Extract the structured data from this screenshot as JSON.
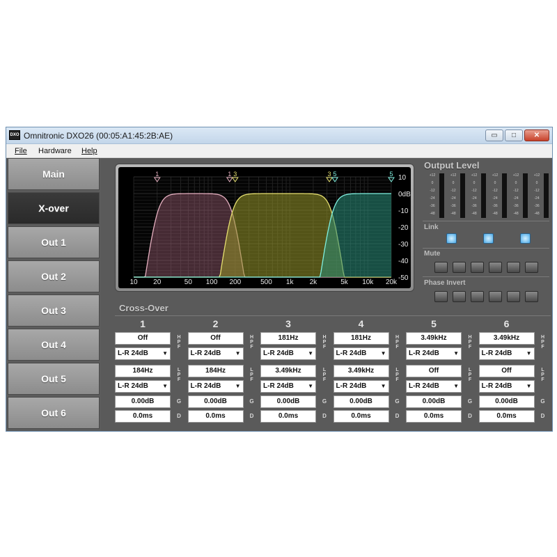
{
  "window": {
    "title": "Omnitronic DXO26 (00:05:A1:45:2B:AE)",
    "icon_text": "DXO",
    "controls": {
      "minimize": "▭",
      "maximize": "□",
      "close": "✕"
    }
  },
  "menu": [
    {
      "label": "File",
      "underline": true
    },
    {
      "label": "Hardware",
      "underline": false
    },
    {
      "label": "Help",
      "underline": true
    }
  ],
  "nav": [
    {
      "label": "Main",
      "active": false
    },
    {
      "label": "X-over",
      "active": true
    },
    {
      "label": "Out 1",
      "active": false
    },
    {
      "label": "Out 2",
      "active": false
    },
    {
      "label": "Out 3",
      "active": false
    },
    {
      "label": "Out 4",
      "active": false
    },
    {
      "label": "Out 5",
      "active": false
    },
    {
      "label": "Out 6",
      "active": false
    }
  ],
  "graph": {
    "x_ticks": [
      "10",
      "20",
      "50",
      "100",
      "200",
      "500",
      "1k",
      "2k",
      "5k",
      "10k",
      "20k"
    ],
    "x_tick_values": [
      10,
      20,
      50,
      100,
      200,
      500,
      1000,
      2000,
      5000,
      10000,
      20000
    ],
    "y_ticks": [
      "10",
      "0dB",
      "-10",
      "-20",
      "-30",
      "-40",
      "-50"
    ],
    "y_tick_values": [
      10,
      0,
      -10,
      -20,
      -30,
      -40,
      -50
    ],
    "x_range": [
      10,
      20000
    ],
    "y_range": [
      -50,
      10
    ],
    "markers": [
      {
        "label": "1",
        "freq": 20,
        "color": "#e6b0c0"
      },
      {
        "label": "1",
        "freq": 184,
        "color": "#e6b0c0"
      },
      {
        "label": "3",
        "freq": 184,
        "color": "#e6e070"
      },
      {
        "label": "3",
        "freq": 3490,
        "color": "#e6e070"
      },
      {
        "label": "5",
        "freq": 3490,
        "color": "#80f0e0"
      },
      {
        "label": "5",
        "freq": 20000,
        "color": "#80f0e0"
      }
    ],
    "bands": [
      {
        "name_hidden": "pair-1-2",
        "hpf": 20,
        "lpf": 184,
        "fill": "rgba(150,90,110,0.45)",
        "stroke": "#e6b0c0"
      },
      {
        "name_hidden": "pair-3-4",
        "hpf": 181,
        "lpf": 3490,
        "fill": "rgba(150,150,40,0.55)",
        "stroke": "#e6e070"
      },
      {
        "name_hidden": "pair-5-6",
        "hpf": 3490,
        "lpf": 20000,
        "fill": "rgba(40,140,120,0.55)",
        "stroke": "#80f0e0"
      }
    ]
  },
  "output_level": {
    "title": "Output Level",
    "scale": [
      "+12",
      "0",
      "-12",
      "-24",
      "-36",
      "-48"
    ]
  },
  "link": {
    "title": "Link",
    "count": 3
  },
  "mute": {
    "title": "Mute",
    "count": 6
  },
  "phase": {
    "title": "Phase Invert",
    "count": 6
  },
  "crossover": {
    "title": "Cross-Over",
    "hpf_label": [
      "H",
      "P",
      "F"
    ],
    "lpf_label": [
      "L",
      "P",
      "F"
    ],
    "gain_label": "G",
    "delay_label": "D",
    "channels": [
      {
        "num": "1",
        "hpf": "Off",
        "hpf_type": "L-R 24dB",
        "lpf": "184Hz",
        "lpf_type": "L-R 24dB",
        "gain": "0.00dB",
        "delay": "0.0ms"
      },
      {
        "num": "2",
        "hpf": "Off",
        "hpf_type": "L-R 24dB",
        "lpf": "184Hz",
        "lpf_type": "L-R 24dB",
        "gain": "0.00dB",
        "delay": "0.0ms"
      },
      {
        "num": "3",
        "hpf": "181Hz",
        "hpf_type": "L-R 24dB",
        "lpf": "3.49kHz",
        "lpf_type": "L-R 24dB",
        "gain": "0.00dB",
        "delay": "0.0ms"
      },
      {
        "num": "4",
        "hpf": "181Hz",
        "hpf_type": "L-R 24dB",
        "lpf": "3.49kHz",
        "lpf_type": "L-R 24dB",
        "gain": "0.00dB",
        "delay": "0.0ms"
      },
      {
        "num": "5",
        "hpf": "3.49kHz",
        "hpf_type": "L-R 24dB",
        "lpf": "Off",
        "lpf_type": "L-R 24dB",
        "gain": "0.00dB",
        "delay": "0.0ms"
      },
      {
        "num": "6",
        "hpf": "3.49kHz",
        "hpf_type": "L-R 24dB",
        "lpf": "Off",
        "lpf_type": "L-R 24dB",
        "gain": "0.00dB",
        "delay": "0.0ms"
      }
    ]
  }
}
